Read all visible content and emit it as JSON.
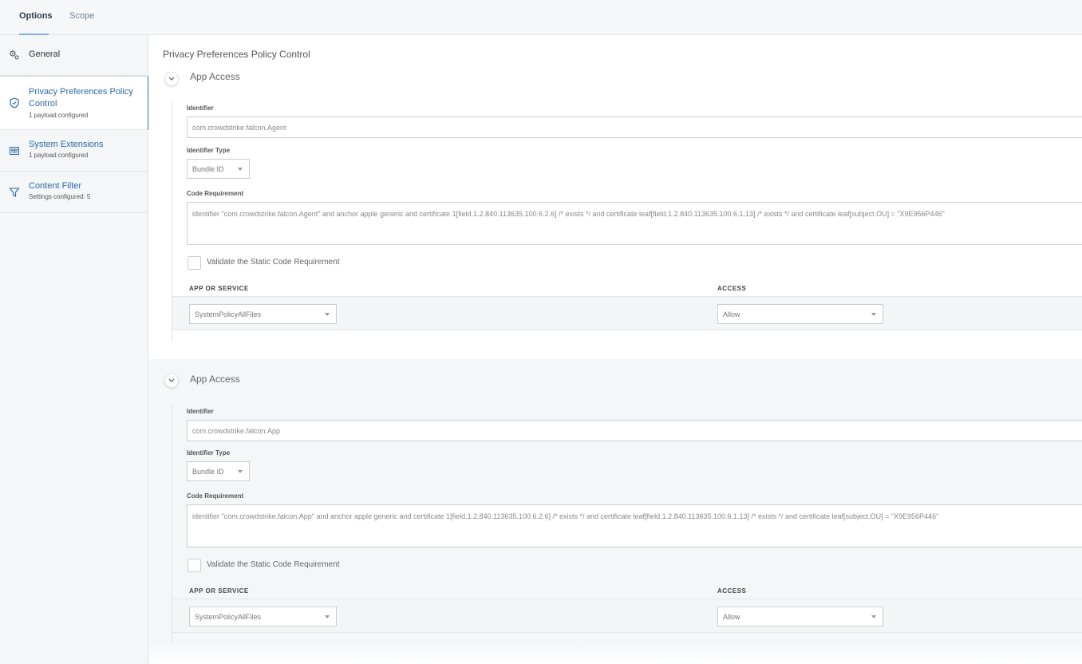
{
  "tabs": {
    "options": "Options",
    "scope": "Scope"
  },
  "sidebar": {
    "items": [
      {
        "label": "General",
        "sub": "",
        "icon": "gear-icon"
      },
      {
        "label": "Privacy Preferences Policy Control",
        "sub": "1 payload configured",
        "icon": "shield-icon"
      },
      {
        "label": "System Extensions",
        "sub": "1 payload configured",
        "icon": "extensions-icon"
      },
      {
        "label": "Content Filter",
        "sub": "Settings configured: 5",
        "icon": "filter-icon"
      }
    ]
  },
  "main": {
    "title": "Privacy Preferences Policy Control",
    "groups": [
      {
        "title": "App Access",
        "identifier_label": "Identifier",
        "identifier": "com.crowdstrike.falcon.Agent",
        "identifier_type_label": "Identifier Type",
        "identifier_type": "Bundle ID",
        "code_req_label": "Code Requirement",
        "code_req": "identifier \"com.crowdstrike.falcon.Agent\" and anchor apple generic and certificate 1[field.1.2.840.113635.100.6.2.6] /* exists */ and certificate leaf[field.1.2.840.113635.100.6.1.13] /* exists */ and certificate leaf[subject.OU] = \"X9E956P446\"",
        "validate_label": "Validate the Static Code Requirement",
        "col_app": "APP OR SERVICE",
        "col_access": "ACCESS",
        "app_service": "SystemPolicyAllFiles",
        "access": "Allow"
      },
      {
        "title": "App Access",
        "identifier_label": "Identifier",
        "identifier": "com.crowdstrike.falcon.App",
        "identifier_type_label": "Identifier Type",
        "identifier_type": "Bundle ID",
        "code_req_label": "Code Requirement",
        "code_req": "identifier \"com.crowdstrike.falcon.App\" and anchor apple generic and certificate 1[field.1.2.840.113635.100.6.2.6] /* exists */ and certificate leaf[field.1.2.840.113635.100.6.1.13] /* exists */ and certificate leaf[subject.OU] = \"X9E956P446\"",
        "validate_label": "Validate the Static Code Requirement",
        "col_app": "APP OR SERVICE",
        "col_access": "ACCESS",
        "app_service": "SystemPolicyAllFiles",
        "access": "Allow"
      }
    ]
  },
  "colors": {
    "accent": "#2a6aa8",
    "tab_underline": "#7fb2de"
  }
}
